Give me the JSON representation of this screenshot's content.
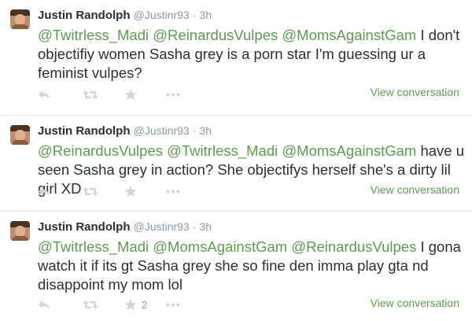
{
  "colors": {
    "mention": "#5e9a52",
    "meta": "#8899a6",
    "action_icon": "#ccd6dd",
    "divider": "#e1e8ed"
  },
  "tweets": [
    {
      "name": "Justin Randolph",
      "handle": "@Justinr93",
      "time": "· 3h",
      "mentions": [
        "@Twitrless_Madi",
        "@ReinardusVulpes",
        "@MomsAgainstGam"
      ],
      "body": " I don't objectifiy women Sasha grey is a porn star I'm guessing ur a feminist vulpes?",
      "favorites": "",
      "view_conversation": "View conversation"
    },
    {
      "name": "Justin Randolph",
      "handle": "@Justinr93",
      "time": "· 3h",
      "mentions": [
        "@ReinardusVulpes",
        "@Twitrless_Madi",
        "@MomsAgainstGam"
      ],
      "body": " have u seen Sasha grey in action? She objectifys herself she's a dirty lil girl XD",
      "favorites": "",
      "view_conversation": "View conversation"
    },
    {
      "name": "Justin Randolph",
      "handle": "@Justinr93",
      "time": "· 3h",
      "mentions": [
        "@Twitrless_Madi",
        "@MomsAgainstGam",
        "@ReinardusVulpes"
      ],
      "body": " I gona watch it if its gt Sasha grey she so fine den imma play gta nd disappoint my mom lol",
      "favorites": "2",
      "view_conversation": "View conversation"
    }
  ]
}
